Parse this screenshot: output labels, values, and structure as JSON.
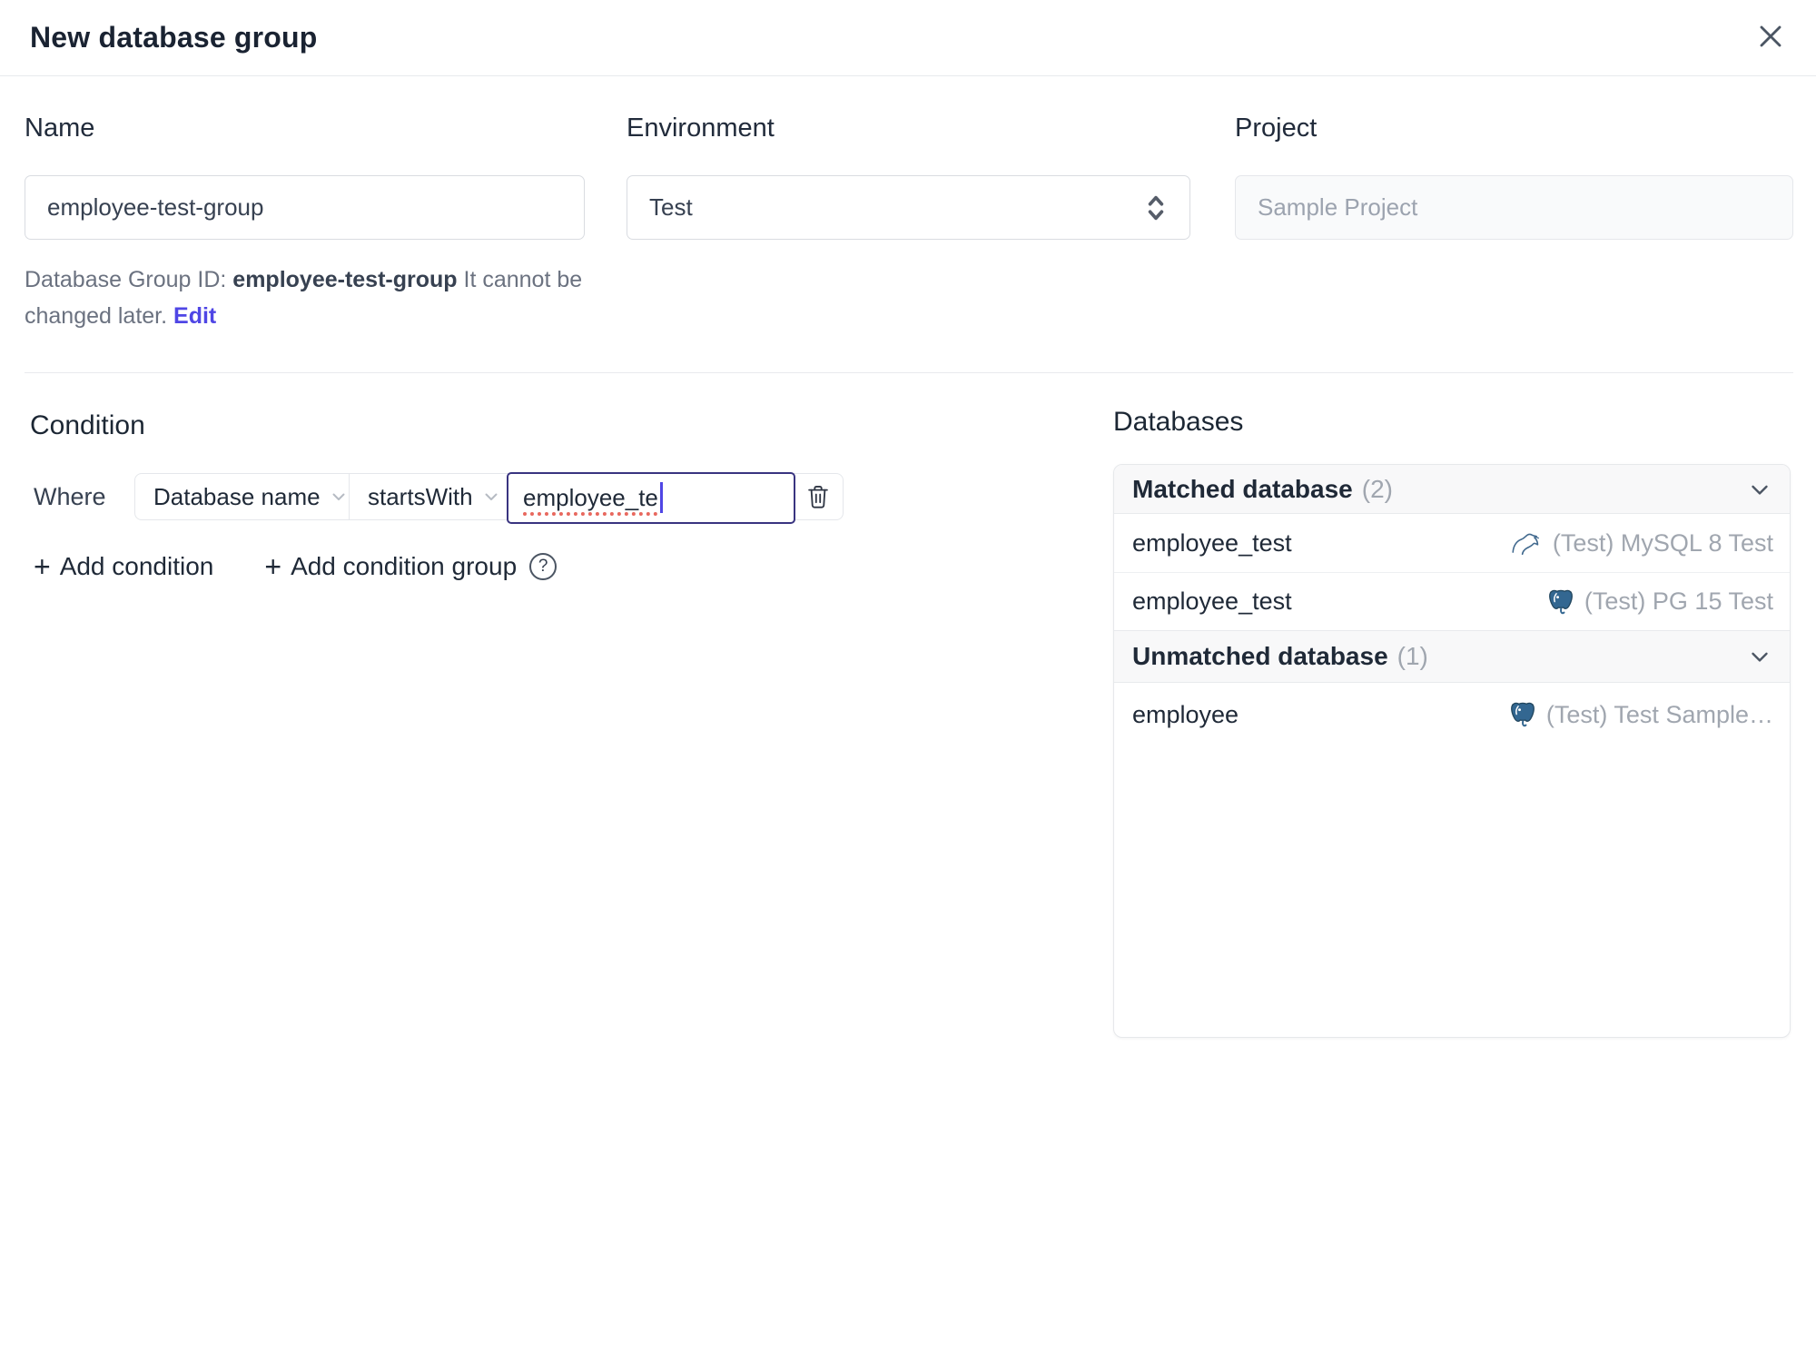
{
  "header": {
    "title": "New database group"
  },
  "icons": {
    "plus": "+",
    "help": "?"
  },
  "form": {
    "name": {
      "label": "Name",
      "value": "employee-test-group"
    },
    "environment": {
      "label": "Environment",
      "value": "Test"
    },
    "project": {
      "label": "Project",
      "value": "Sample Project"
    },
    "helper": {
      "prefix": "Database Group ID: ",
      "id": "employee-test-group",
      "suffix": " It cannot be changed later. ",
      "edit_label": "Edit"
    }
  },
  "condition": {
    "title": "Condition",
    "where_label": "Where",
    "factor": "Database name",
    "operator": "startsWith",
    "value": "employee_te",
    "add_condition": "Add condition",
    "add_condition_group": "Add condition group"
  },
  "databases": {
    "title": "Databases",
    "sections": [
      {
        "label": "Matched database",
        "count": "(2)",
        "rows": [
          {
            "name": "employee_test",
            "engine": "mysql",
            "instance": "(Test) MySQL 8 Test"
          },
          {
            "name": "employee_test",
            "engine": "postgres",
            "instance": "(Test) PG 15 Test"
          }
        ]
      },
      {
        "label": "Unmatched database",
        "count": "(1)",
        "rows": [
          {
            "name": "employee",
            "engine": "postgres",
            "instance": "(Test) Test Sample…"
          }
        ]
      }
    ]
  },
  "colors": {
    "accent": "#4f46e5",
    "focus_border": "#393480",
    "spellcheck_underline": "#e8685e",
    "mysql_icon": "#41698e",
    "postgres_icon": "#336791",
    "muted_text": "#a0a6af",
    "divider": "#e8eaed",
    "section_header_bg": "#f8f8f9"
  }
}
